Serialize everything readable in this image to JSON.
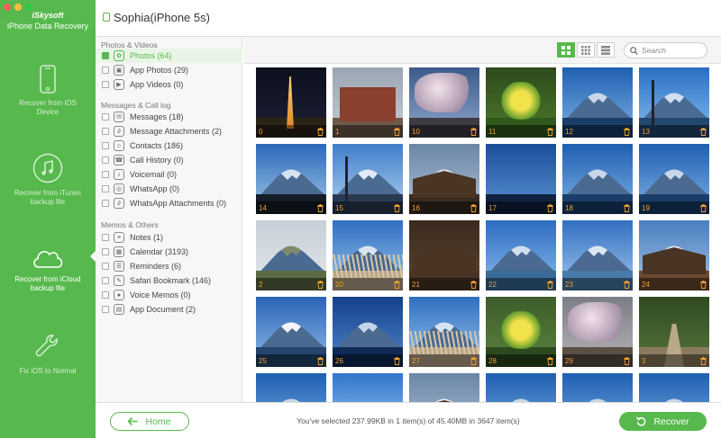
{
  "app": {
    "brand": "iSkysoft",
    "product": "iPhone Data Recovery"
  },
  "window_controls": [
    "close",
    "minimize",
    "zoom"
  ],
  "sidebar": {
    "items": [
      {
        "label": "Recover from iOS Device",
        "icon": "phone-icon",
        "active": false
      },
      {
        "label": "Recover from iTunes backup file",
        "icon": "music-note-icon",
        "active": false
      },
      {
        "label": "Recover from iCloud backup file",
        "icon": "cloud-icon",
        "active": true
      },
      {
        "label": "Fix iOS to Normal",
        "icon": "wrench-icon",
        "active": false
      }
    ]
  },
  "device": {
    "name": "Sophia(iPhone 5s)"
  },
  "categories": {
    "groups": [
      {
        "title": "Photos & Videos",
        "items": [
          {
            "label": "Photos (64)",
            "checked": true,
            "selected": true,
            "icon": "photos-icon"
          },
          {
            "label": "App Photos (29)",
            "checked": false,
            "selected": false,
            "icon": "app-photos-icon"
          },
          {
            "label": "App Videos (0)",
            "checked": false,
            "selected": false,
            "icon": "video-icon"
          }
        ]
      },
      {
        "title": "Messages & Call log",
        "items": [
          {
            "label": "Messages (18)",
            "checked": false,
            "selected": false,
            "icon": "message-icon"
          },
          {
            "label": "Message Attachments (2)",
            "checked": false,
            "selected": false,
            "icon": "paperclip-icon"
          },
          {
            "label": "Contacts (186)",
            "checked": false,
            "selected": false,
            "icon": "contacts-icon"
          },
          {
            "label": "Call History (0)",
            "checked": false,
            "selected": false,
            "icon": "phone-call-icon"
          },
          {
            "label": "Voicemail (0)",
            "checked": false,
            "selected": false,
            "icon": "voicemail-icon"
          },
          {
            "label": "WhatsApp (0)",
            "checked": false,
            "selected": false,
            "icon": "whatsapp-icon"
          },
          {
            "label": "WhatsApp Attachments (0)",
            "checked": false,
            "selected": false,
            "icon": "paperclip-icon"
          }
        ]
      },
      {
        "title": "Memos & Others",
        "items": [
          {
            "label": "Notes (1)",
            "checked": false,
            "selected": false,
            "icon": "notes-icon"
          },
          {
            "label": "Calendar (3193)",
            "checked": false,
            "selected": false,
            "icon": "calendar-icon"
          },
          {
            "label": "Reminders (6)",
            "checked": false,
            "selected": false,
            "icon": "reminders-icon"
          },
          {
            "label": "Safari Bookmark (146)",
            "checked": false,
            "selected": false,
            "icon": "bookmark-icon"
          },
          {
            "label": "Voice Memos (0)",
            "checked": false,
            "selected": false,
            "icon": "microphone-icon"
          },
          {
            "label": "App Document (2)",
            "checked": false,
            "selected": false,
            "icon": "document-icon"
          }
        ]
      }
    ]
  },
  "toolbar": {
    "views": [
      {
        "name": "large-grid-view",
        "active": true
      },
      {
        "name": "small-grid-view",
        "active": false
      },
      {
        "name": "list-view",
        "active": false
      }
    ],
    "search_placeholder": "Search"
  },
  "photos": [
    {
      "num": "0",
      "scene": "tower-night"
    },
    {
      "num": "1",
      "scene": "building"
    },
    {
      "num": "10",
      "scene": "blossom"
    },
    {
      "num": "11",
      "scene": "flowers"
    },
    {
      "num": "12",
      "scene": "fuji-blue"
    },
    {
      "num": "13",
      "scene": "fuji-sign"
    },
    {
      "num": "14",
      "scene": "fuji-silhouette"
    },
    {
      "num": "15",
      "scene": "fuji-lamp"
    },
    {
      "num": "16",
      "scene": "village"
    },
    {
      "num": "17",
      "scene": "lake-dark"
    },
    {
      "num": "18",
      "scene": "fuji-blue"
    },
    {
      "num": "19",
      "scene": "fuji-blue"
    },
    {
      "num": "2",
      "scene": "valley"
    },
    {
      "num": "20",
      "scene": "fuji-grass"
    },
    {
      "num": "21",
      "scene": "shop"
    },
    {
      "num": "22",
      "scene": "lake-boats"
    },
    {
      "num": "23",
      "scene": "fuji-boats"
    },
    {
      "num": "24",
      "scene": "cafe"
    },
    {
      "num": "25",
      "scene": "fuji-white"
    },
    {
      "num": "26",
      "scene": "fuji-lake"
    },
    {
      "num": "27",
      "scene": "fuji-grass"
    },
    {
      "num": "28",
      "scene": "garden"
    },
    {
      "num": "29",
      "scene": "blossom-path"
    },
    {
      "num": "3",
      "scene": "forest-bridge"
    },
    {
      "num": "",
      "scene": "fuji-blue"
    },
    {
      "num": "",
      "scene": "sky"
    },
    {
      "num": "",
      "scene": "village"
    },
    {
      "num": "",
      "scene": "fuji-blue"
    },
    {
      "num": "",
      "scene": "fuji-blue"
    },
    {
      "num": "",
      "scene": "fuji-blue"
    }
  ],
  "footer": {
    "home_label": "Home",
    "status": "You've selected 237.99KB in 1 item(s) of 45.40MB in 3647 item(s)",
    "recover_label": "Recover"
  },
  "colors": {
    "accent": "#57b94d",
    "selected_row": "#e9f5e6",
    "photo_number": "#f0a030"
  }
}
